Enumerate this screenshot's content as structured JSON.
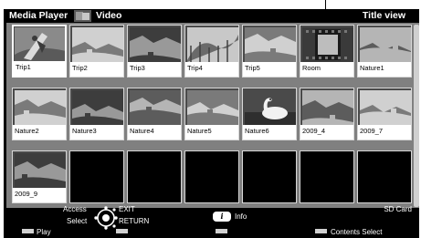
{
  "header": {
    "app_title": "Media Player",
    "section_title": "Video",
    "view_label": "Title view"
  },
  "tiles": [
    {
      "label": "Trip1",
      "thumb": "person-surfing",
      "selected": true
    },
    {
      "label": "Trip2",
      "thumb": "landscape"
    },
    {
      "label": "Trip3",
      "thumb": "landscape"
    },
    {
      "label": "Trip4",
      "thumb": "water-slide"
    },
    {
      "label": "Trip5",
      "thumb": "landscape"
    },
    {
      "label": "Room",
      "thumb": "film-frame"
    },
    {
      "label": "Nature1",
      "thumb": "landscape"
    },
    {
      "label": "Nature2",
      "thumb": "landscape"
    },
    {
      "label": "Nature3",
      "thumb": "landscape"
    },
    {
      "label": "Nature4",
      "thumb": "landscape"
    },
    {
      "label": "Nature5",
      "thumb": "landscape"
    },
    {
      "label": "Nature6",
      "thumb": "swan"
    },
    {
      "label": "2009_4",
      "thumb": "landscape"
    },
    {
      "label": "2009_7",
      "thumb": "landscape"
    },
    {
      "label": "2009_9",
      "thumb": "landscape"
    },
    {
      "label": ""
    },
    {
      "label": ""
    },
    {
      "label": ""
    },
    {
      "label": ""
    },
    {
      "label": ""
    },
    {
      "label": ""
    }
  ],
  "footer": {
    "access_label": "Access",
    "select_label": "Select",
    "exit_label": "EXIT",
    "return_label": "RETURN",
    "info_label": "Info",
    "info_icon_glyph": "i",
    "storage_label": "SD Card",
    "red_label": "Play",
    "green_label": "",
    "yellow_label": "",
    "blue_label": "Contents Select"
  }
}
